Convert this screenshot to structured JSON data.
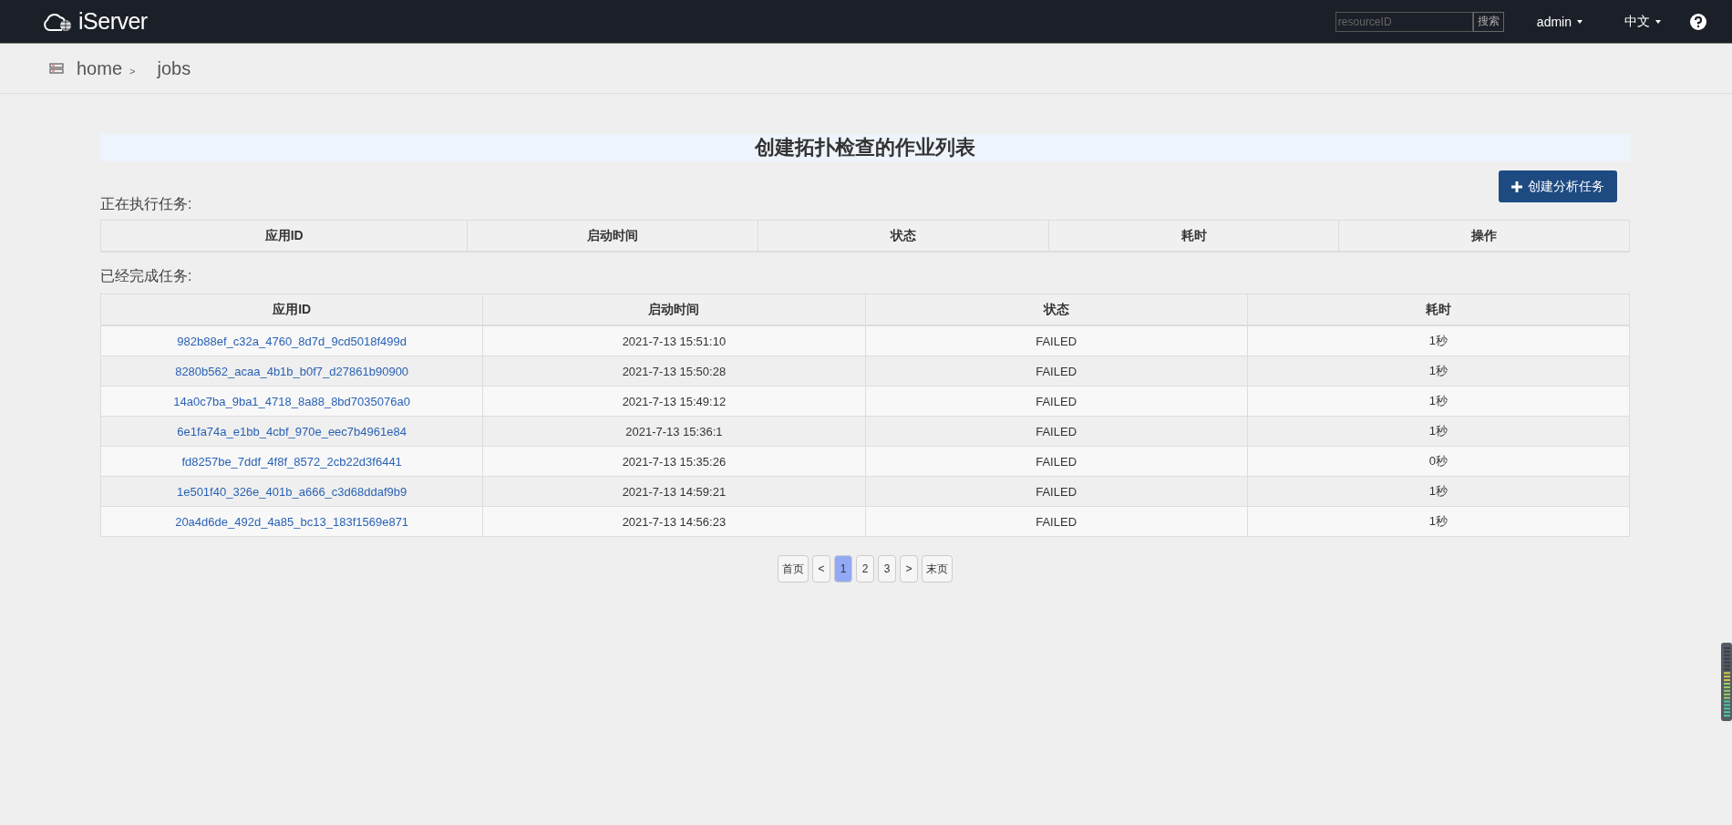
{
  "header": {
    "logo": "iServer",
    "search": {
      "placeholder": "resourceID",
      "button": "搜索"
    },
    "user_menu": "admin",
    "language_menu": "中文"
  },
  "breadcrumb": [
    "home",
    "jobs"
  ],
  "breadcrumb_separator": ">",
  "title": "创建拓扑检查的作业列表",
  "create_button": "创建分析任务",
  "running": {
    "label": "正在执行任务:",
    "columns": [
      "应用ID",
      "启动时间",
      "状态",
      "耗时",
      "操作"
    ]
  },
  "finished": {
    "label": "已经完成任务:",
    "columns": [
      "应用ID",
      "启动时间",
      "状态",
      "耗时"
    ],
    "rows": [
      {
        "id": "982b88ef_c32a_4760_8d7d_9cd5018f499d",
        "start": "2021-7-13 15:51:10",
        "status": "FAILED",
        "duration": "1秒"
      },
      {
        "id": "8280b562_acaa_4b1b_b0f7_d27861b90900",
        "start": "2021-7-13 15:50:28",
        "status": "FAILED",
        "duration": "1秒"
      },
      {
        "id": "14a0c7ba_9ba1_4718_8a88_8bd7035076a0",
        "start": "2021-7-13 15:49:12",
        "status": "FAILED",
        "duration": "1秒"
      },
      {
        "id": "6e1fa74a_e1bb_4cbf_970e_eec7b4961e84",
        "start": "2021-7-13 15:36:1",
        "status": "FAILED",
        "duration": "1秒"
      },
      {
        "id": "fd8257be_7ddf_4f8f_8572_2cb22d3f6441",
        "start": "2021-7-13 15:35:26",
        "status": "FAILED",
        "duration": "0秒"
      },
      {
        "id": "1e501f40_326e_401b_a666_c3d68ddaf9b9",
        "start": "2021-7-13 14:59:21",
        "status": "FAILED",
        "duration": "1秒"
      },
      {
        "id": "20a4d6de_492d_4a85_bc13_183f1569e871",
        "start": "2021-7-13 14:56:23",
        "status": "FAILED",
        "duration": "1秒"
      }
    ]
  },
  "pagination": [
    {
      "label": "首页",
      "selected": false
    },
    {
      "label": "<",
      "selected": false
    },
    {
      "label": "1",
      "selected": true
    },
    {
      "label": "2",
      "selected": false
    },
    {
      "label": "3",
      "selected": false
    },
    {
      "label": ">",
      "selected": false
    },
    {
      "label": "末页",
      "selected": false
    }
  ]
}
